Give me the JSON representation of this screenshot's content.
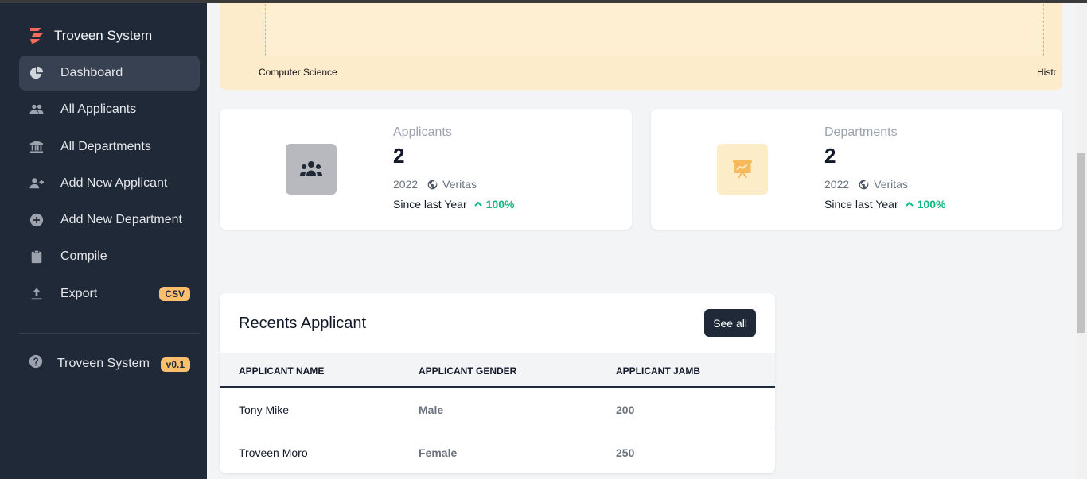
{
  "sidebar": {
    "brand": "Troveen System",
    "items": [
      {
        "label": "Dashboard",
        "icon": "pie-chart-icon"
      },
      {
        "label": "All Applicants",
        "icon": "users-icon"
      },
      {
        "label": "All Departments",
        "icon": "bank-icon"
      },
      {
        "label": "Add New Applicant",
        "icon": "user-plus-icon"
      },
      {
        "label": "Add New Department",
        "icon": "plus-circle-icon"
      },
      {
        "label": "Compile",
        "icon": "clipboard-icon"
      },
      {
        "label": "Export",
        "icon": "upload-icon",
        "badge": "CSV"
      }
    ],
    "footer": {
      "label": "Troveen System",
      "badge": "v0.1",
      "icon": "help-icon"
    }
  },
  "chart": {
    "labels": [
      "Computer Science",
      "Histo"
    ]
  },
  "cards": [
    {
      "title": "Applicants",
      "value": "2",
      "year": "2022",
      "org": "Veritas",
      "since": "Since last Year",
      "change": "100%"
    },
    {
      "title": "Departments",
      "value": "2",
      "year": "2022",
      "org": "Veritas",
      "since": "Since last Year",
      "change": "100%"
    }
  ],
  "recent": {
    "title": "Recents Applicant",
    "see_all": "See all",
    "columns": [
      "APPLICANT NAME",
      "APPLICANT GENDER",
      "APPLICANT JAMB"
    ],
    "rows": [
      {
        "name": "Tony Mike",
        "gender": "Male",
        "jamb": "200"
      },
      {
        "name": "Troveen Moro",
        "gender": "Female",
        "jamb": "250"
      }
    ]
  },
  "colors": {
    "sidebar_bg": "#1f2937",
    "accent_badge": "#fbbf6e",
    "positive": "#10b981",
    "chart_bg": "#fdeccb"
  }
}
